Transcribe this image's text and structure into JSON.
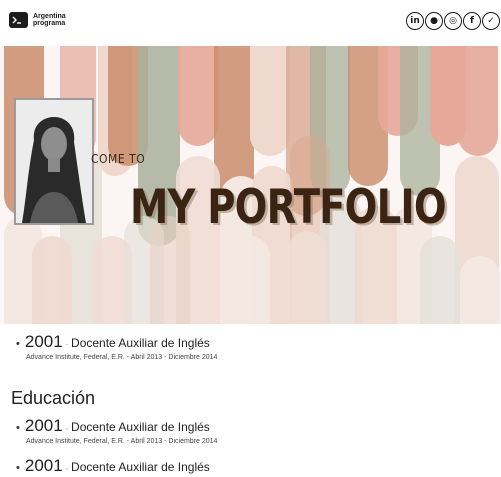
{
  "header": {
    "logo": {
      "line1": "Argentina",
      "line2": "programa",
      "icon": "terminal-prompt-icon"
    },
    "socials": [
      {
        "icon": "linkedin-icon",
        "glyph": "in"
      },
      {
        "icon": "github-icon",
        "glyph": "●"
      },
      {
        "icon": "instagram-icon",
        "glyph": "◎"
      },
      {
        "icon": "facebook-icon",
        "glyph": "f"
      },
      {
        "icon": "twitter-icon",
        "glyph": "✓"
      }
    ]
  },
  "hero": {
    "welcome": "COME TO",
    "title": "MY PORTFOLIO",
    "colors": {
      "terracotta": "#c98c6a",
      "peach": "#e6a899",
      "sage": "#a9b09b",
      "blush": "#efd9cf",
      "cream": "#f3e9e2",
      "title": "#3b2414"
    }
  },
  "experience": [
    {
      "year": "2001",
      "separator": "-",
      "role": "Docente Auxiliar de Inglés",
      "detail": "Advance Institute, Federal, E.R. - Abril 2013 - Diciembre 2014"
    }
  ],
  "education": {
    "title": "Educación",
    "items": [
      {
        "year": "2001",
        "separator": "-",
        "role": "Docente Auxiliar de Inglés",
        "detail": "Advance Institute, Federal, E.R. - Abril 2013 - Diciembre 2014"
      },
      {
        "year": "2001",
        "separator": "-",
        "role": "Docente Auxiliar de Inglés",
        "detail": ""
      }
    ]
  }
}
